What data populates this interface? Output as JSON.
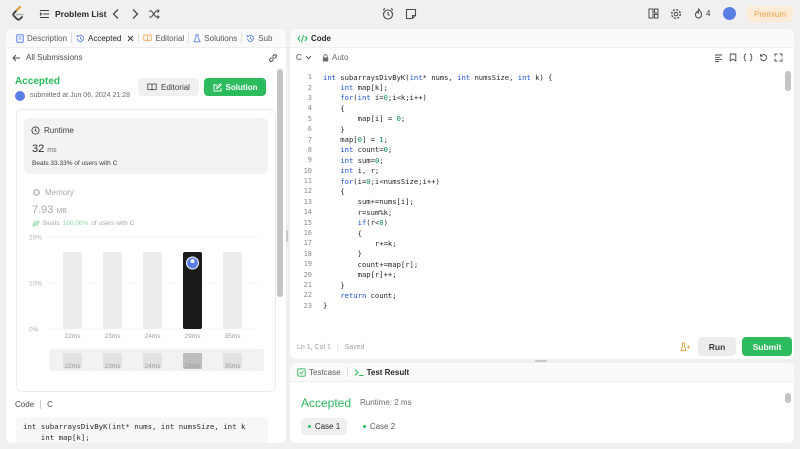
{
  "topnav": {
    "problem_list_label": "Problem List",
    "streak_count": "4",
    "premium_label": "Premium",
    "accent": "#f0a24a"
  },
  "left_tabs": [
    {
      "label": "Description",
      "icon": "description-icon"
    },
    {
      "label": "Accepted",
      "icon": "history-icon",
      "active": true
    },
    {
      "label": "Editorial",
      "icon": "editorial-icon"
    },
    {
      "label": "Solutions",
      "icon": "flask-icon"
    },
    {
      "label": "Sub",
      "icon": "history-icon"
    }
  ],
  "submission": {
    "back_label": "All Submissions",
    "status": "Accepted",
    "submitted_text": "submitted at Jun 06, 2024 21:28",
    "editorial_button": "Editorial",
    "solution_button": "Solution",
    "status_color": "#2cbb5d"
  },
  "runtime": {
    "label": "Runtime",
    "value": "32",
    "unit": "ms",
    "beats_text": "Beats 33.33% of users with C"
  },
  "memory": {
    "label": "Memory",
    "value": "7.93",
    "unit": "MB",
    "beats_prefix": "Beats",
    "beats_pct": "100.00%",
    "beats_suffix": "of users with C"
  },
  "chart_data": {
    "type": "bar",
    "categories": [
      "22ms",
      "23ms",
      "24ms",
      "29ms",
      "35ms"
    ],
    "values": [
      null,
      null,
      null,
      null,
      null
    ],
    "highlighted_index": 3,
    "y_tick_labels": [
      "20%",
      "10%",
      "0%"
    ],
    "xlabel": "",
    "ylabel": ""
  },
  "code_preview": {
    "label": "Code",
    "language": "C",
    "lines": [
      "int subarraysDivByK(int* nums, int numsSize, int k",
      "    int map[k];"
    ]
  },
  "editor": {
    "tab_label": "Code",
    "language": "C",
    "indent_mode": "Auto",
    "status": "Ln 1, Col 1",
    "saved": "Saved",
    "run_label": "Run",
    "submit_label": "Submit",
    "lines": [
      "int subarraysDivByK(int* nums, int numsSize, int k) {",
      "    int map[k];",
      "    for(int i=0;i<k;i++)",
      "    {",
      "        map[i] = 0;",
      "    }",
      "    map[0] = 1;",
      "    int count=0;",
      "    int sum=0;",
      "    int i, r;",
      "    for(i=0;i<numsSize;i++)",
      "    {",
      "        sum+=nums[i];",
      "        r=sum%k;",
      "        if(r<0)",
      "        {",
      "            r+=k;",
      "        }",
      "        count+=map[r];",
      "        map[r]++;",
      "    }",
      "    return count;",
      "}"
    ]
  },
  "test_panel": {
    "testcase_tab": "Testcase",
    "result_tab": "Test Result",
    "result_status": "Accepted",
    "runtime_text": "Runtime: 2 ms",
    "cases": [
      "Case 1",
      "Case 2"
    ]
  }
}
